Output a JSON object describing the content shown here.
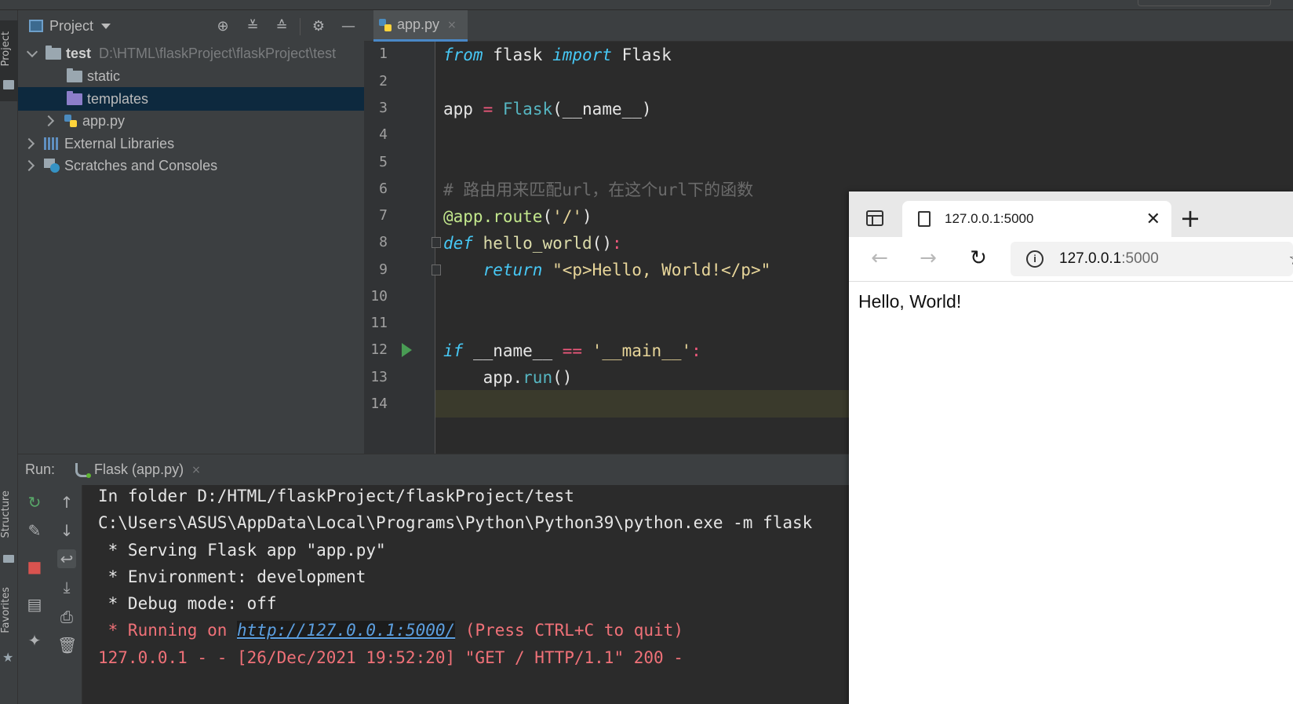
{
  "left_stripe": {
    "project_label": "Project",
    "structure_label": "Structure",
    "favorites_label": "Favorites"
  },
  "project_panel": {
    "title": "Project",
    "header_icons": [
      "target-icon",
      "expand-all-icon",
      "collapse-all-icon",
      "gear-icon",
      "minimize-icon"
    ],
    "tree": [
      {
        "name": "test",
        "detail": "D:\\HTML\\flaskProject\\flaskProject\\test",
        "expanded": true,
        "icon": "folder-icon"
      },
      {
        "name": "static",
        "icon": "folder-icon"
      },
      {
        "name": "templates",
        "icon": "folder-purple-icon",
        "selected": true
      },
      {
        "name": "app.py",
        "icon": "python-file-icon"
      },
      {
        "name": "External Libraries",
        "icon": "library-icon"
      },
      {
        "name": "Scratches and Consoles",
        "icon": "scratches-icon"
      }
    ]
  },
  "editor": {
    "tab_label": "app.py",
    "tab_close": "×",
    "line_numbers": [
      "1",
      "2",
      "3",
      "4",
      "5",
      "6",
      "7",
      "8",
      "9",
      "10",
      "11",
      "12",
      "13",
      "14"
    ],
    "current_line": 14
  },
  "run_panel": {
    "label": "Run:",
    "tab_label": "Flask (app.py)",
    "tab_close": "×",
    "console_lines": [
      "In folder D:/HTML/flaskProject/flaskProject/test",
      "C:\\Users\\ASUS\\AppData\\Local\\Programs\\Python\\Python39\\python.exe -m flask",
      " * Serving Flask app \"app.py\"",
      " * Environment: development",
      " * Debug mode: off",
      "127.0.0.1 - - [26/Dec/2021 19:52:20] \"GET / HTTP/1.1\" 200 -"
    ],
    "running_prefix": " * Running on ",
    "running_url": "http://127.0.0.1:5000/",
    "running_suffix": " (Press CTRL+C to quit)"
  },
  "browser": {
    "tab_title": "127.0.0.1:5000",
    "tab_close": "✕",
    "new_tab": "+",
    "address_host": "127.0.0.1",
    "address_port": ":5000",
    "page_text": "Hello, World!"
  },
  "colors": {
    "ide_background": "#2b2b2b",
    "panel_background": "#3c3f41",
    "selection": "#0d293e",
    "keyword": "#47c8f5",
    "string": "#e8d69a",
    "console_error": "#f07178"
  }
}
